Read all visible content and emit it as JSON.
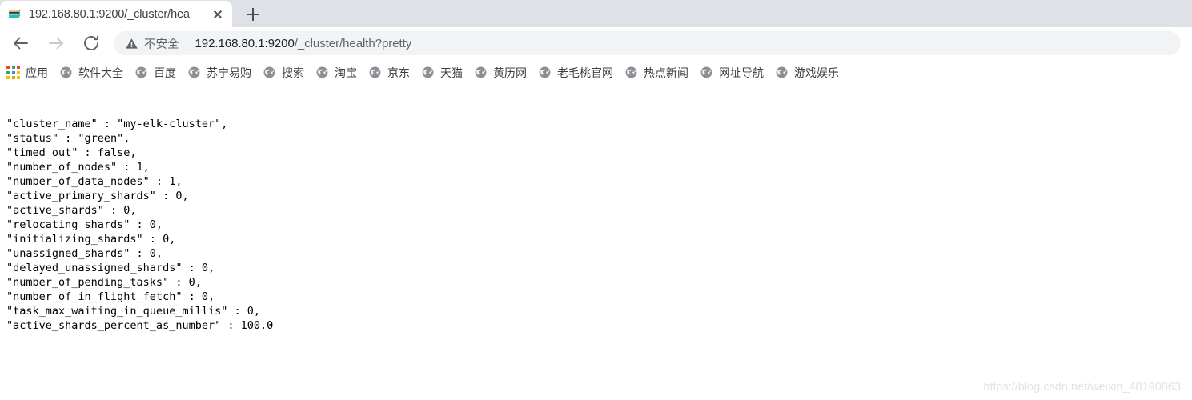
{
  "browser": {
    "tab": {
      "title": "192.168.80.1:9200/_cluster/hea",
      "favicon": "elasticsearch-icon",
      "close_icon": "close-icon"
    },
    "new_tab_icon": "plus-icon",
    "toolbar": {
      "back_icon": "back-arrow-icon",
      "forward_icon": "forward-arrow-icon",
      "reload_icon": "reload-icon"
    },
    "omnibox": {
      "security_icon": "warning-triangle-icon",
      "security_text": "不安全",
      "url_prefix": "192.168.80.1:9200",
      "url_path": "/_cluster/health?pretty",
      "full_url": "192.168.80.1:9200/_cluster/health?pretty"
    },
    "bookmarks": {
      "apps": {
        "label": "应用",
        "icon": "apps-grid-icon"
      },
      "items": [
        {
          "label": "软件大全",
          "icon": "globe-icon"
        },
        {
          "label": "百度",
          "icon": "globe-icon"
        },
        {
          "label": "苏宁易购",
          "icon": "globe-icon"
        },
        {
          "label": "搜索",
          "icon": "globe-icon"
        },
        {
          "label": "淘宝",
          "icon": "globe-icon"
        },
        {
          "label": "京东",
          "icon": "globe-icon"
        },
        {
          "label": "天猫",
          "icon": "globe-icon"
        },
        {
          "label": "黄历网",
          "icon": "globe-icon"
        },
        {
          "label": "老毛桃官网",
          "icon": "globe-icon"
        },
        {
          "label": "热点新闻",
          "icon": "globe-icon"
        },
        {
          "label": "网址导航",
          "icon": "globe-icon"
        },
        {
          "label": "游戏娱乐",
          "icon": "globe-icon"
        }
      ]
    }
  },
  "page": {
    "response_lines": [
      "\"cluster_name\" : \"my-elk-cluster\",",
      "\"status\" : \"green\",",
      "\"timed_out\" : false,",
      "\"number_of_nodes\" : 1,",
      "\"number_of_data_nodes\" : 1,",
      "\"active_primary_shards\" : 0,",
      "\"active_shards\" : 0,",
      "\"relocating_shards\" : 0,",
      "\"initializing_shards\" : 0,",
      "\"unassigned_shards\" : 0,",
      "\"delayed_unassigned_shards\" : 0,",
      "\"number_of_pending_tasks\" : 0,",
      "\"number_of_in_flight_fetch\" : 0,",
      "\"task_max_waiting_in_queue_millis\" : 0,",
      "\"active_shards_percent_as_number\" : 100.0"
    ],
    "fields": {
      "cluster_name": "my-elk-cluster",
      "status": "green",
      "timed_out": "false",
      "number_of_nodes": "1",
      "number_of_data_nodes": "1",
      "active_primary_shards": "0",
      "active_shards": "0",
      "relocating_shards": "0",
      "initializing_shards": "0",
      "unassigned_shards": "0",
      "delayed_unassigned_shards": "0",
      "number_of_pending_tasks": "0",
      "number_of_in_flight_fetch": "0",
      "task_max_waiting_in_queue_millis": "0",
      "active_shards_percent_as_number": "100.0"
    },
    "watermark": "https://blog.csdn.net/weixin_48190863"
  },
  "colors": {
    "tabstrip_bg": "#dee1e6",
    "omnibox_bg": "#f1f3f4",
    "text_primary": "#202124",
    "text_secondary": "#5f6368",
    "watermark": "#e3e3e3",
    "apps_red": "#ea4335",
    "apps_green": "#34a853",
    "apps_blue": "#4285f4",
    "apps_yellow": "#fbbc05",
    "apps_orange": "#f29900",
    "elastic_yellow": "#f0bf1a",
    "elastic_blue": "#00bfb3",
    "elastic_teal": "#24bbb1",
    "elastic_dark": "#343741"
  }
}
